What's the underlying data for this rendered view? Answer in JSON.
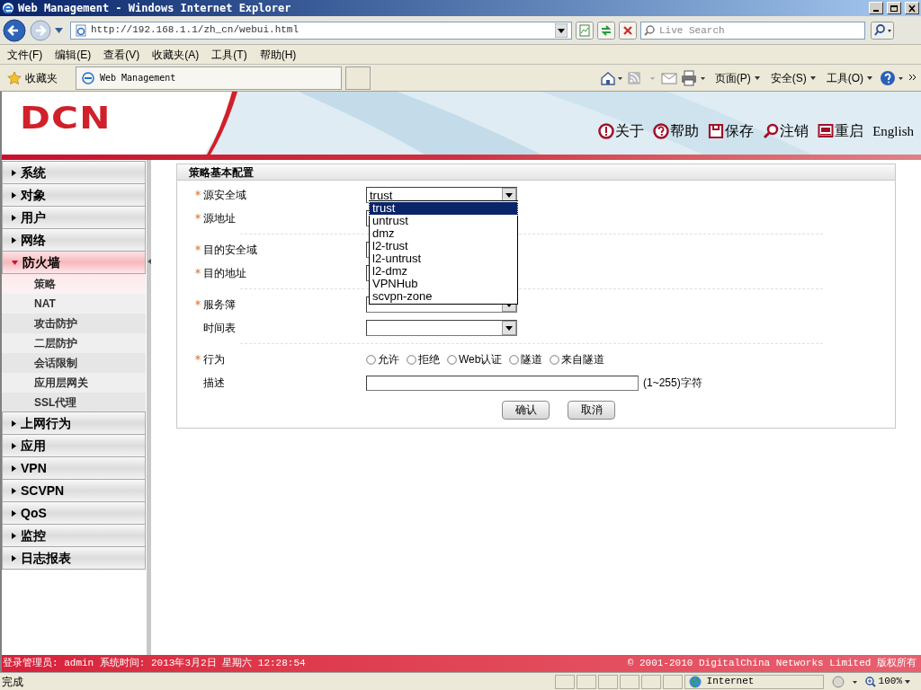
{
  "window": {
    "title": "Web Management - Windows Internet Explorer"
  },
  "address": {
    "value": "http://192.168.1.1/zh_cn/webui.html"
  },
  "search": {
    "placeholder": "Live Search"
  },
  "menu": [
    "文件(F)",
    "编辑(E)",
    "查看(V)",
    "收藏夹(A)",
    "工具(T)",
    "帮助(H)"
  ],
  "favorites": {
    "label": "收藏夹",
    "tab": "Web Management"
  },
  "commands": [
    "页面(P)",
    "安全(S)",
    "工具(O)"
  ],
  "header": {
    "logo": "DCN",
    "links": [
      {
        "label": "关于",
        "kind": "about"
      },
      {
        "label": "帮助",
        "kind": "help"
      },
      {
        "label": "保存",
        "kind": "save"
      },
      {
        "label": "注销",
        "kind": "logout"
      },
      {
        "label": "重启",
        "kind": "restart"
      }
    ],
    "language": "English"
  },
  "sidebar": {
    "items": [
      {
        "label": "系统",
        "expanded": false
      },
      {
        "label": "对象",
        "expanded": false
      },
      {
        "label": "用户",
        "expanded": false
      },
      {
        "label": "网络",
        "expanded": false
      },
      {
        "label": "防火墙",
        "expanded": true,
        "children": [
          {
            "label": "策略",
            "selected": true
          },
          {
            "label": "NAT",
            "selected": false
          },
          {
            "label": "攻击防护",
            "selected": false
          },
          {
            "label": "二层防护",
            "selected": false
          },
          {
            "label": "会话限制",
            "selected": false
          },
          {
            "label": "应用层网关",
            "selected": false
          },
          {
            "label": "SSL代理",
            "selected": false
          }
        ]
      },
      {
        "label": "上网行为",
        "expanded": false
      },
      {
        "label": "应用",
        "expanded": false
      },
      {
        "label": "VPN",
        "expanded": false
      },
      {
        "label": "SCVPN",
        "expanded": false
      },
      {
        "label": "QoS",
        "expanded": false
      },
      {
        "label": "监控",
        "expanded": false
      },
      {
        "label": "日志报表",
        "expanded": false
      }
    ]
  },
  "form": {
    "title": "策略基本配置",
    "fields": [
      {
        "label": "源安全域",
        "required": true,
        "kind": "select",
        "value": "trust"
      },
      {
        "label": "源地址",
        "required": true,
        "kind": "select",
        "covered": true
      },
      {
        "kind": "divider"
      },
      {
        "label": "目的安全域",
        "required": true,
        "kind": "select",
        "covered": true
      },
      {
        "label": "目的地址",
        "required": true,
        "kind": "select",
        "covered": true
      },
      {
        "kind": "divider"
      },
      {
        "label": "服务簿",
        "required": true,
        "kind": "select"
      },
      {
        "label": "时间表",
        "required": false,
        "kind": "select"
      },
      {
        "kind": "divider"
      },
      {
        "label": "行为",
        "required": true,
        "kind": "radio",
        "options": [
          {
            "label": "允许",
            "selected": false
          },
          {
            "label": "拒绝",
            "selected": false
          },
          {
            "label": "Web认证",
            "selected": false
          },
          {
            "label": "隧道",
            "selected": false
          },
          {
            "label": "来自隧道",
            "selected": false
          }
        ]
      },
      {
        "label": "描述",
        "required": false,
        "kind": "text",
        "hint": "(1~255)字符"
      }
    ],
    "dropdown": [
      {
        "label": "trust",
        "selected": true
      },
      {
        "label": "untrust",
        "selected": false
      },
      {
        "label": "dmz",
        "selected": false
      },
      {
        "label": "l2-trust",
        "selected": false
      },
      {
        "label": "l2-untrust",
        "selected": false
      },
      {
        "label": "l2-dmz",
        "selected": false
      },
      {
        "label": "VPNHub",
        "selected": false
      },
      {
        "label": "scvpn-zone",
        "selected": false
      }
    ],
    "buttons": [
      "确认",
      "取消"
    ]
  },
  "footer": {
    "left": "登录管理员: admin 系统时间: 2013年3月2日 星期六 12:28:54",
    "right": "© 2001-2010 DigitalChina Networks Limited 版权所有"
  },
  "status_bar": {
    "text": "完成",
    "zone": "Internet",
    "zoom": "100%"
  }
}
